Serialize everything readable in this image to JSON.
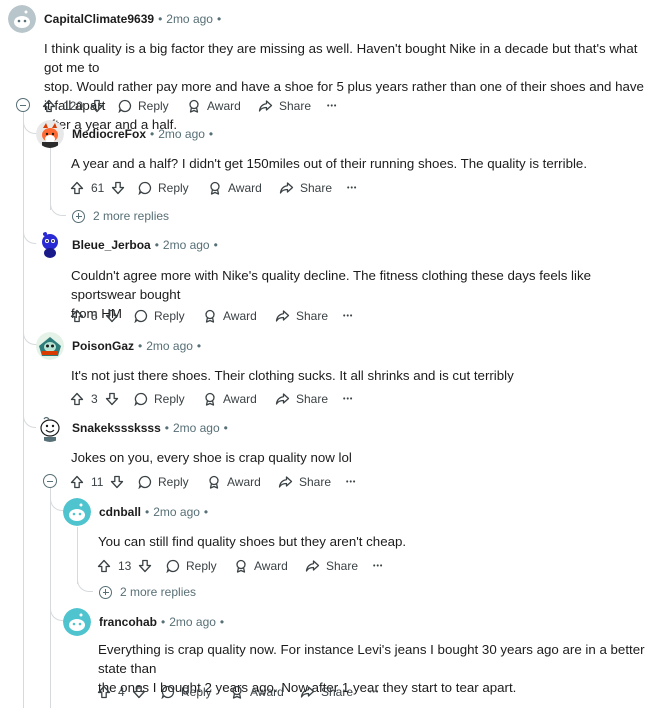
{
  "labels": {
    "reply": "Reply",
    "award": "Award",
    "share": "Share",
    "more": "•••",
    "dot": "•"
  },
  "colors": {
    "meta_gray": "#576f76",
    "rail": "#d7dadc",
    "text": "#1c1c1c"
  },
  "comments": [
    {
      "author": "CapitalClimate9639",
      "time": "2mo ago",
      "avatar": "snoo-gray",
      "lines": [
        "I think quality is a big factor they are missing as well. Haven't bought Nike in a decade but that's what got me to",
        "stop. Would rather pay more and have a shoe for 5 plus years rather than one of their shoes and have it fall apart",
        "after a year and a half."
      ],
      "votes": "120"
    },
    {
      "author": "MediocreFox",
      "time": "2mo ago",
      "avatar": "snoo-fox",
      "lines": [
        "A year and a half? I didn't get 150miles out of their running shoes. The quality is terrible."
      ],
      "votes": "61",
      "more_replies": "2 more replies"
    },
    {
      "author": "Bleue_Jerboa",
      "time": "2mo ago",
      "avatar": "snoo-blue",
      "lines": [
        "Couldn't agree more with Nike's quality decline. The fitness clothing these days feels like sportswear bought",
        "from HM"
      ],
      "votes": "5"
    },
    {
      "author": "PoisonGaz",
      "time": "2mo ago",
      "avatar": "snoo-gas",
      "lines": [
        "It's not just there shoes. Their clothing sucks. It all shrinks and is cut terribly"
      ],
      "votes": "3"
    },
    {
      "author": "Snakeksssksss",
      "time": "2mo ago",
      "avatar": "snoo-smile",
      "lines": [
        "Jokes on you, every shoe is crap quality now lol"
      ],
      "votes": "11"
    },
    {
      "author": "cdnball",
      "time": "2mo ago",
      "avatar": "snoo-teal",
      "lines": [
        "You can still find quality shoes but they aren't cheap."
      ],
      "votes": "13",
      "more_replies": "2 more replies"
    },
    {
      "author": "francohab",
      "time": "2mo ago",
      "avatar": "snoo-teal",
      "lines": [
        "Everything is crap quality now. For instance Levi's jeans I bought 30 years ago are in a better state than",
        "the ones I bought 2 years ago. Now after 1 year they start to tear apart."
      ],
      "votes": "4"
    }
  ]
}
